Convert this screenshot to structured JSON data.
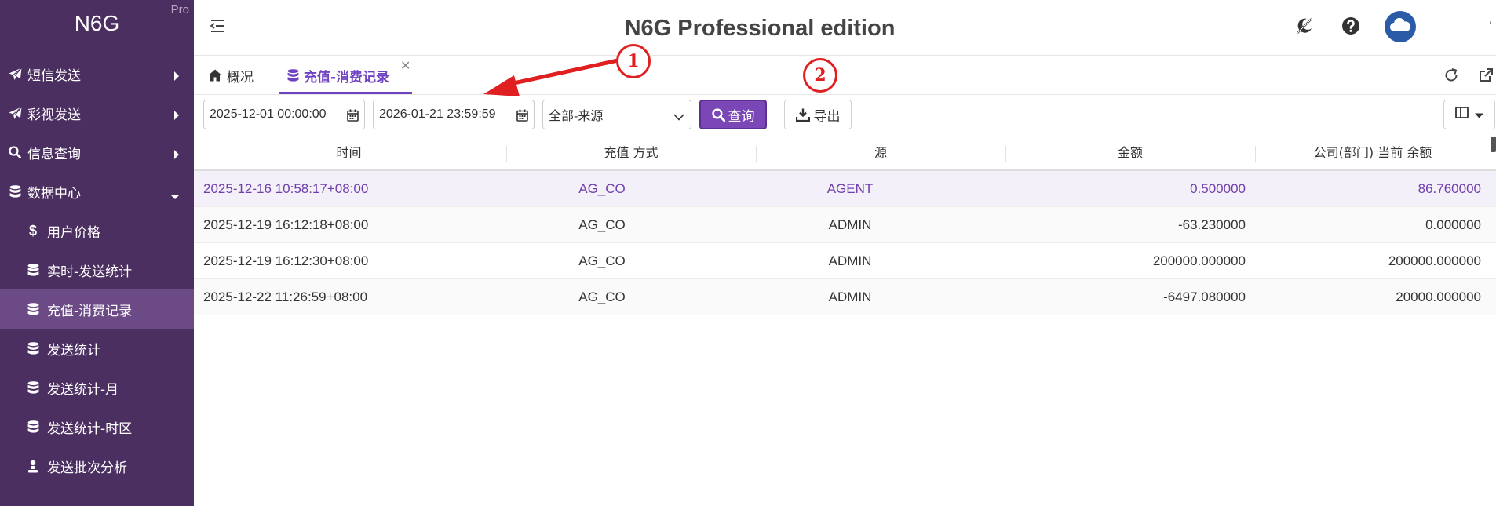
{
  "sidebar": {
    "brand": "N6G",
    "brand_tag": "Pro",
    "items": [
      {
        "label": "短信发送",
        "icon": "paper-plane-icon"
      },
      {
        "label": "彩视发送",
        "icon": "paper-plane-icon"
      },
      {
        "label": "信息查询",
        "icon": "search-icon"
      },
      {
        "label": "数据中心",
        "icon": "database-icon"
      },
      {
        "label": "用户价格",
        "icon": "dollar-icon"
      },
      {
        "label": "实时-发送统计",
        "icon": "database-icon"
      },
      {
        "label": "充值-消费记录",
        "icon": "database-icon",
        "active": true
      },
      {
        "label": "发送统计",
        "icon": "database-icon"
      },
      {
        "label": "发送统计-月",
        "icon": "database-icon"
      },
      {
        "label": "发送统计-时区",
        "icon": "database-icon"
      },
      {
        "label": "发送批次分析",
        "icon": "person-icon"
      }
    ]
  },
  "header": {
    "title": "N6G Professional edition"
  },
  "tabs": [
    {
      "label": "概况",
      "icon": "home-icon"
    },
    {
      "label": "充值-消费记录",
      "icon": "database-icon",
      "active": true
    }
  ],
  "toolbar": {
    "start_date": "2025-12-01 00:00:00",
    "end_date": "2026-01-21 23:59:59",
    "source_select": "全部-来源",
    "query_label": "查询",
    "export_label": "导出"
  },
  "table": {
    "headers": [
      "时间",
      "充值 方式",
      "源",
      "金额",
      "公司(部门) 当前 余额"
    ],
    "rows": [
      [
        "2025-12-16 10:58:17+08:00",
        "AG_CO",
        "AGENT",
        "0.500000",
        "86.760000"
      ],
      [
        "2025-12-19 16:12:18+08:00",
        "AG_CO",
        "ADMIN",
        "-63.230000",
        "0.000000"
      ],
      [
        "2025-12-19 16:12:30+08:00",
        "AG_CO",
        "ADMIN",
        "200000.000000",
        "200000.000000"
      ],
      [
        "2025-12-22 11:26:59+08:00",
        "AG_CO",
        "ADMIN",
        "-6497.080000",
        "20000.000000"
      ]
    ]
  },
  "annotations": {
    "badge_1": "1",
    "badge_2": "2"
  },
  "colors": {
    "sidebar_bg": "#4b2f61",
    "sidebar_active": "#6b4a85",
    "accent": "#6f42c1",
    "annotation_red": "#e02020"
  }
}
